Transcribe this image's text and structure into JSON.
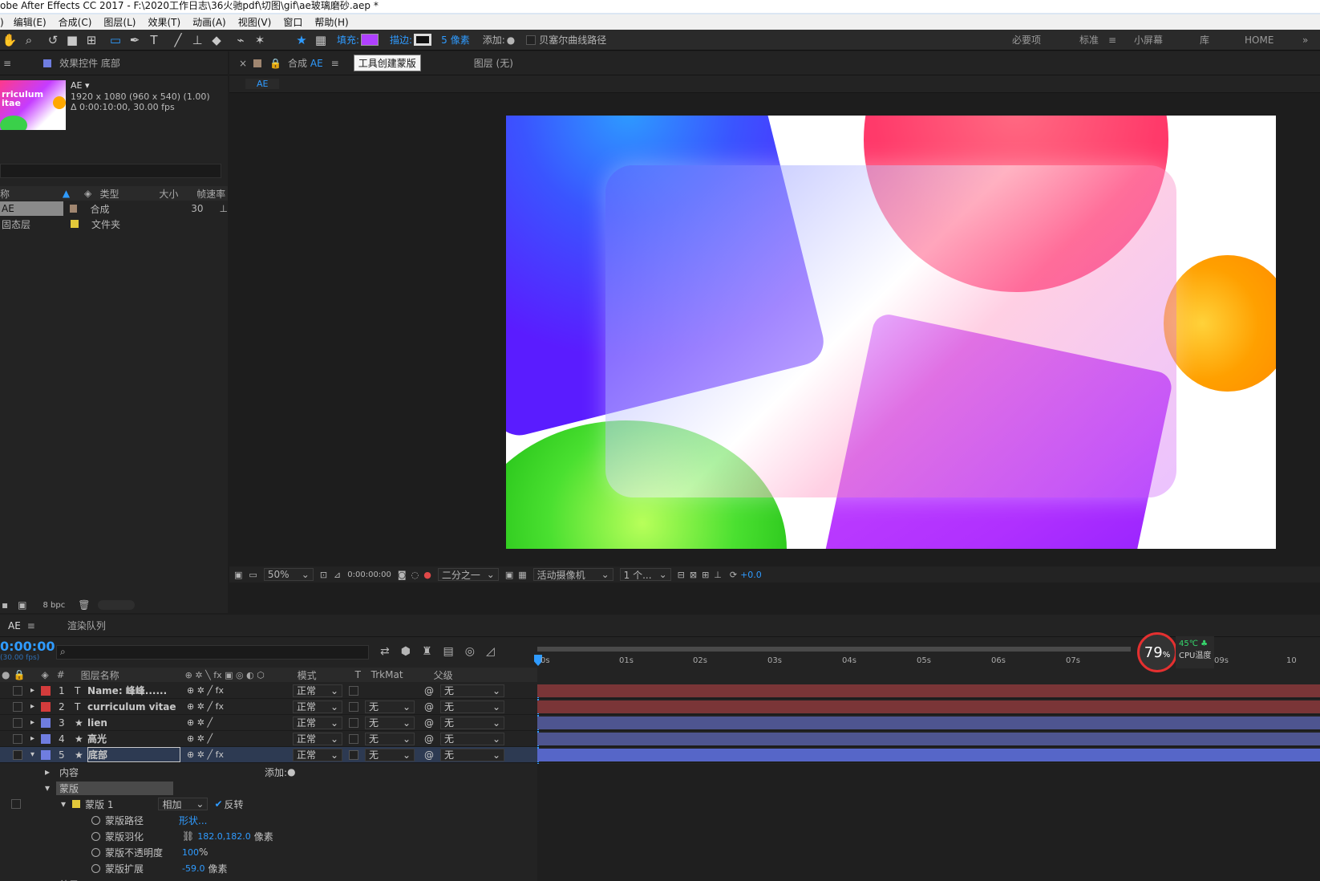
{
  "title": "obe After Effects CC 2017 - F:\\2020工作日志\\36火驰pdf\\切图\\gif\\ae玻璃磨砂.aep *",
  "menu": [
    "编辑(E)",
    "合成(C)",
    "图层(L)",
    "效果(T)",
    "动画(A)",
    "视图(V)",
    "窗口",
    "帮助(H)"
  ],
  "menu_lead": ")",
  "toolbar": {
    "fill_label": "填充:",
    "stroke_label": "描边:",
    "stroke_value": "5",
    "stroke_unit": "像素",
    "add_label": "添加:",
    "bezier_label": "贝塞尔曲线路径",
    "fill_color": "#b040ff"
  },
  "workspaces": [
    "必要项",
    "标准",
    "小屏幕",
    "库",
    "HOME"
  ],
  "project": {
    "effects_tab": "效果控件 底部",
    "comp_name": "AE",
    "comp_size": "1920 x 1080  (960 x 540) (1.00)",
    "comp_dur": "Δ 0:00:10:00, 30.00 fps",
    "thumb_text": "rriculum\nitae",
    "cols": {
      "name": "称",
      "type": "类型",
      "size": "大小",
      "fps": "帧速率"
    },
    "items": [
      {
        "name": "AE",
        "type": "合成",
        "fps": "30",
        "color": "#a08670"
      },
      {
        "name": "固态层",
        "type": "文件夹",
        "fps": "",
        "color": "#e2c83a"
      }
    ],
    "bpc": "8 bpc"
  },
  "comp": {
    "tab_label": "合成",
    "tab_name": "AE",
    "tooltip": "工具创建蒙版",
    "layer_tab": "图层  (无)",
    "sub_tab": "AE",
    "zoom": "50%",
    "time": "0:00:00:00",
    "resolution": "二分之一",
    "camera": "活动摄像机",
    "views": "1 个...",
    "exposure": "+0.0"
  },
  "timeline": {
    "tab": "AE",
    "render_tab": "渲染队列",
    "timecode": "0:00:00",
    "fps_note": "(30.00 fps)",
    "cols": {
      "num": "#",
      "name": "图层名称",
      "mode": "模式",
      "t": "T",
      "trkmat": "TrkMat",
      "parent": "父级"
    },
    "ruler": [
      "0s",
      "01s",
      "02s",
      "03s",
      "04s",
      "05s",
      "06s",
      "07s",
      "09s",
      "10"
    ],
    "layers": [
      {
        "num": "1",
        "type": "T",
        "name": "Name: 峰峰......",
        "mode": "正常",
        "trk": "",
        "parent": "无",
        "label": "#d43c3c",
        "bar": "#7a3537"
      },
      {
        "num": "2",
        "type": "T",
        "name": "curriculum vitae",
        "mode": "正常",
        "trk": "无",
        "parent": "无",
        "label": "#d43c3c",
        "bar": "#7a3537"
      },
      {
        "num": "3",
        "type": "★",
        "name": "lien",
        "mode": "正常",
        "trk": "无",
        "parent": "无",
        "label": "#6f7de0",
        "bar": "#4e5590"
      },
      {
        "num": "4",
        "type": "★",
        "name": "高光",
        "mode": "正常",
        "trk": "无",
        "parent": "无",
        "label": "#6f7de0",
        "bar": "#4e5590"
      },
      {
        "num": "5",
        "type": "★",
        "name": "底部",
        "mode": "正常",
        "trk": "无",
        "parent": "无",
        "label": "#6f7de0",
        "bar": "#5666c8"
      }
    ],
    "props": {
      "content": "内容",
      "add": "添加:",
      "masks": "蒙版",
      "mask1": "蒙版 1",
      "mask_mode": "相加",
      "invert": "反转",
      "path": "蒙版路径",
      "path_val": "形状...",
      "feather": "蒙版羽化",
      "feather_val": "182.0,182.0",
      "feather_unit": "像素",
      "opacity": "蒙版不透明度",
      "opacity_val": "100",
      "opacity_unit": "%",
      "expansion": "蒙版扩展",
      "expansion_val": "-59.0",
      "expansion_unit": "像素",
      "more": "效果"
    }
  },
  "cpu": {
    "usage": "79",
    "usage_unit": "%",
    "temp": "45℃",
    "label": "CPU温度"
  }
}
